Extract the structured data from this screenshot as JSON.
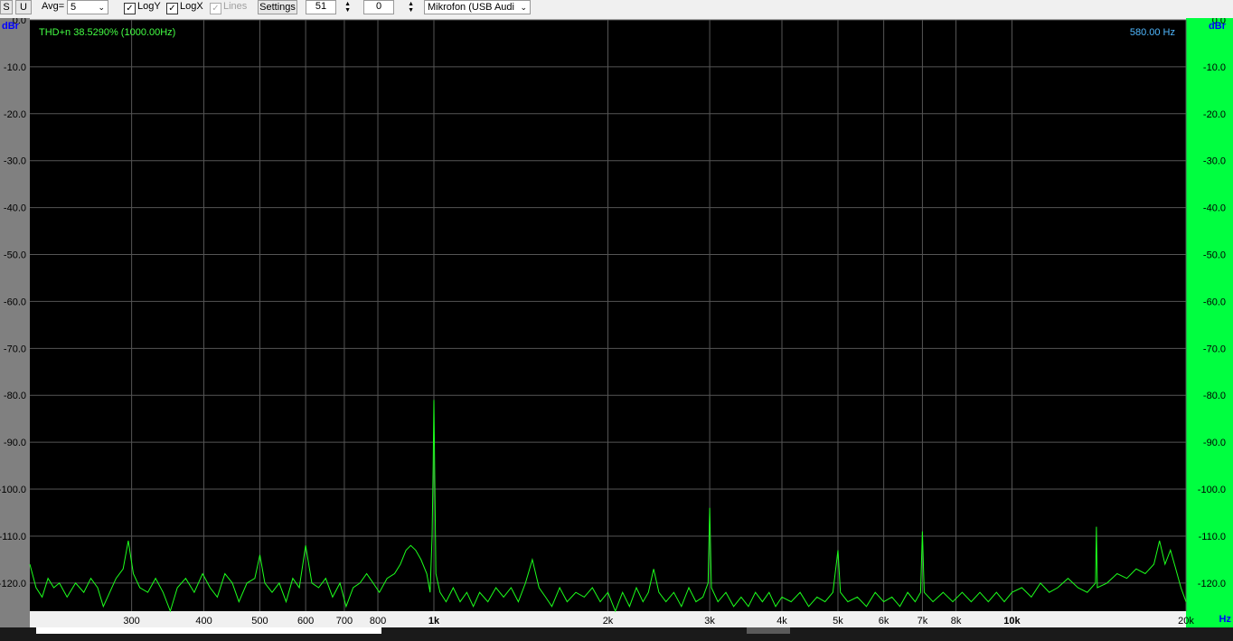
{
  "toolbar": {
    "s_label": "S",
    "u_label": "U",
    "avg_label": "Avg=",
    "avg_value": "5",
    "logy_label": "LogY",
    "logx_label": "LogX",
    "lines_label": "Lines",
    "settings_label": "Settings",
    "spin1_value": "51",
    "spin2_value": "0",
    "device_value": "Mikrofon (USB Audi"
  },
  "colors": {
    "plot_bg": "#000000",
    "grid": "#555555",
    "trace": "#1cff1c",
    "left_axis_bg": "#808080",
    "right_axis_bg": "#00ff40",
    "axis_unit": "#0000ff",
    "readout": "#50b8ff",
    "thd_text": "#44ff44"
  },
  "chart_data": {
    "type": "line",
    "title": "",
    "annotations": {
      "thd": "THD+n 38.5290% (1000.00Hz)",
      "freq_readout": "580.00 Hz"
    },
    "ylabel_left": "dBr",
    "ylabel_right": "dBr",
    "xlabel": "Hz",
    "xscale": "log",
    "xlim": [
      200,
      20000
    ],
    "ylim": [
      -126,
      0
    ],
    "grid": true,
    "y_ticks": [
      {
        "value": 0,
        "label": "0.0"
      },
      {
        "value": -10,
        "label": "-10.0"
      },
      {
        "value": -20,
        "label": "-20.0"
      },
      {
        "value": -30,
        "label": "-30.0"
      },
      {
        "value": -40,
        "label": "-40.0"
      },
      {
        "value": -50,
        "label": "-50.0"
      },
      {
        "value": -60,
        "label": "-60.0"
      },
      {
        "value": -70,
        "label": "-70.0"
      },
      {
        "value": -80,
        "label": "-80.0"
      },
      {
        "value": -90,
        "label": "-90.0"
      },
      {
        "value": -100,
        "label": "-100.0"
      },
      {
        "value": -110,
        "label": "-110.0"
      },
      {
        "value": -120,
        "label": "-120.0"
      }
    ],
    "x_ticks": [
      {
        "value": 300,
        "label": "300"
      },
      {
        "value": 400,
        "label": "400"
      },
      {
        "value": 500,
        "label": "500"
      },
      {
        "value": 600,
        "label": "600"
      },
      {
        "value": 700,
        "label": "700"
      },
      {
        "value": 800,
        "label": "800"
      },
      {
        "value": 1000,
        "label": "1k",
        "bold": true
      },
      {
        "value": 2000,
        "label": "2k"
      },
      {
        "value": 3000,
        "label": "3k"
      },
      {
        "value": 4000,
        "label": "4k"
      },
      {
        "value": 5000,
        "label": "5k"
      },
      {
        "value": 6000,
        "label": "6k"
      },
      {
        "value": 7000,
        "label": "7k"
      },
      {
        "value": 8000,
        "label": "8k"
      },
      {
        "value": 10000,
        "label": "10k",
        "bold": true
      },
      {
        "value": 20000,
        "label": "20k"
      }
    ],
    "series": [
      {
        "color": "#1cff1c",
        "points": [
          [
            200,
            -116
          ],
          [
            205,
            -121
          ],
          [
            210,
            -123
          ],
          [
            215,
            -119
          ],
          [
            220,
            -121
          ],
          [
            225,
            -120
          ],
          [
            232,
            -123
          ],
          [
            240,
            -120
          ],
          [
            248,
            -122
          ],
          [
            255,
            -119
          ],
          [
            262,
            -121
          ],
          [
            268,
            -125
          ],
          [
            275,
            -122
          ],
          [
            282,
            -119
          ],
          [
            290,
            -117
          ],
          [
            296,
            -111
          ],
          [
            302,
            -118
          ],
          [
            310,
            -121
          ],
          [
            320,
            -122
          ],
          [
            330,
            -119
          ],
          [
            340,
            -122
          ],
          [
            350,
            -126
          ],
          [
            360,
            -121
          ],
          [
            372,
            -119
          ],
          [
            385,
            -122
          ],
          [
            398,
            -118
          ],
          [
            410,
            -121
          ],
          [
            422,
            -123
          ],
          [
            435,
            -118
          ],
          [
            448,
            -120
          ],
          [
            460,
            -124
          ],
          [
            475,
            -120
          ],
          [
            490,
            -119
          ],
          [
            500,
            -114
          ],
          [
            510,
            -120
          ],
          [
            525,
            -122
          ],
          [
            540,
            -120
          ],
          [
            555,
            -124
          ],
          [
            570,
            -119
          ],
          [
            585,
            -121
          ],
          [
            600,
            -112
          ],
          [
            615,
            -120
          ],
          [
            632,
            -121
          ],
          [
            650,
            -119
          ],
          [
            668,
            -123
          ],
          [
            688,
            -120
          ],
          [
            705,
            -125
          ],
          [
            725,
            -121
          ],
          [
            745,
            -120
          ],
          [
            765,
            -118
          ],
          [
            785,
            -120
          ],
          [
            805,
            -122
          ],
          [
            830,
            -119
          ],
          [
            855,
            -118
          ],
          [
            875,
            -116
          ],
          [
            895,
            -113
          ],
          [
            912,
            -112
          ],
          [
            930,
            -113
          ],
          [
            950,
            -115
          ],
          [
            972,
            -118
          ],
          [
            985,
            -122
          ],
          [
            993,
            -110
          ],
          [
            997,
            -95
          ],
          [
            1000,
            -81
          ],
          [
            1003,
            -95
          ],
          [
            1008,
            -118
          ],
          [
            1025,
            -122
          ],
          [
            1050,
            -124
          ],
          [
            1080,
            -121
          ],
          [
            1110,
            -124
          ],
          [
            1140,
            -122
          ],
          [
            1170,
            -125
          ],
          [
            1200,
            -122
          ],
          [
            1240,
            -124
          ],
          [
            1280,
            -121
          ],
          [
            1320,
            -123
          ],
          [
            1360,
            -121
          ],
          [
            1400,
            -124
          ],
          [
            1440,
            -120
          ],
          [
            1480,
            -115
          ],
          [
            1520,
            -121
          ],
          [
            1560,
            -123
          ],
          [
            1600,
            -125
          ],
          [
            1650,
            -121
          ],
          [
            1700,
            -124
          ],
          [
            1760,
            -122
          ],
          [
            1820,
            -123
          ],
          [
            1880,
            -121
          ],
          [
            1940,
            -124
          ],
          [
            2000,
            -122
          ],
          [
            2060,
            -126
          ],
          [
            2120,
            -122
          ],
          [
            2180,
            -125
          ],
          [
            2240,
            -121
          ],
          [
            2300,
            -124
          ],
          [
            2350,
            -122
          ],
          [
            2400,
            -117
          ],
          [
            2450,
            -122
          ],
          [
            2520,
            -124
          ],
          [
            2600,
            -122
          ],
          [
            2680,
            -125
          ],
          [
            2760,
            -121
          ],
          [
            2840,
            -124
          ],
          [
            2920,
            -123
          ],
          [
            2980,
            -120
          ],
          [
            3000,
            -104
          ],
          [
            3020,
            -121
          ],
          [
            3100,
            -124
          ],
          [
            3200,
            -122
          ],
          [
            3300,
            -125
          ],
          [
            3400,
            -123
          ],
          [
            3500,
            -125
          ],
          [
            3600,
            -122
          ],
          [
            3700,
            -124
          ],
          [
            3800,
            -122
          ],
          [
            3900,
            -125
          ],
          [
            4000,
            -123
          ],
          [
            4150,
            -124
          ],
          [
            4300,
            -122
          ],
          [
            4450,
            -125
          ],
          [
            4600,
            -123
          ],
          [
            4750,
            -124
          ],
          [
            4900,
            -122
          ],
          [
            5000,
            -113
          ],
          [
            5050,
            -122
          ],
          [
            5200,
            -124
          ],
          [
            5400,
            -123
          ],
          [
            5600,
            -125
          ],
          [
            5800,
            -122
          ],
          [
            6000,
            -124
          ],
          [
            6200,
            -123
          ],
          [
            6400,
            -125
          ],
          [
            6600,
            -122
          ],
          [
            6800,
            -124
          ],
          [
            6950,
            -122
          ],
          [
            7000,
            -109
          ],
          [
            7050,
            -122
          ],
          [
            7300,
            -124
          ],
          [
            7600,
            -122
          ],
          [
            7900,
            -124
          ],
          [
            8200,
            -122
          ],
          [
            8500,
            -124
          ],
          [
            8800,
            -122
          ],
          [
            9100,
            -124
          ],
          [
            9400,
            -122
          ],
          [
            9700,
            -124
          ],
          [
            10000,
            -122
          ],
          [
            10400,
            -121
          ],
          [
            10800,
            -123
          ],
          [
            11200,
            -120
          ],
          [
            11600,
            -122
          ],
          [
            12000,
            -121
          ],
          [
            12500,
            -119
          ],
          [
            13000,
            -121
          ],
          [
            13500,
            -122
          ],
          [
            13950,
            -120
          ],
          [
            14000,
            -108
          ],
          [
            14050,
            -121
          ],
          [
            14600,
            -120
          ],
          [
            15200,
            -118
          ],
          [
            15800,
            -119
          ],
          [
            16400,
            -117
          ],
          [
            17000,
            -118
          ],
          [
            17600,
            -116
          ],
          [
            18000,
            -111
          ],
          [
            18400,
            -116
          ],
          [
            18800,
            -113
          ],
          [
            19200,
            -117
          ],
          [
            19600,
            -121
          ],
          [
            20000,
            -124
          ]
        ]
      }
    ]
  },
  "bottom_bar": {
    "progress": 0.28
  }
}
